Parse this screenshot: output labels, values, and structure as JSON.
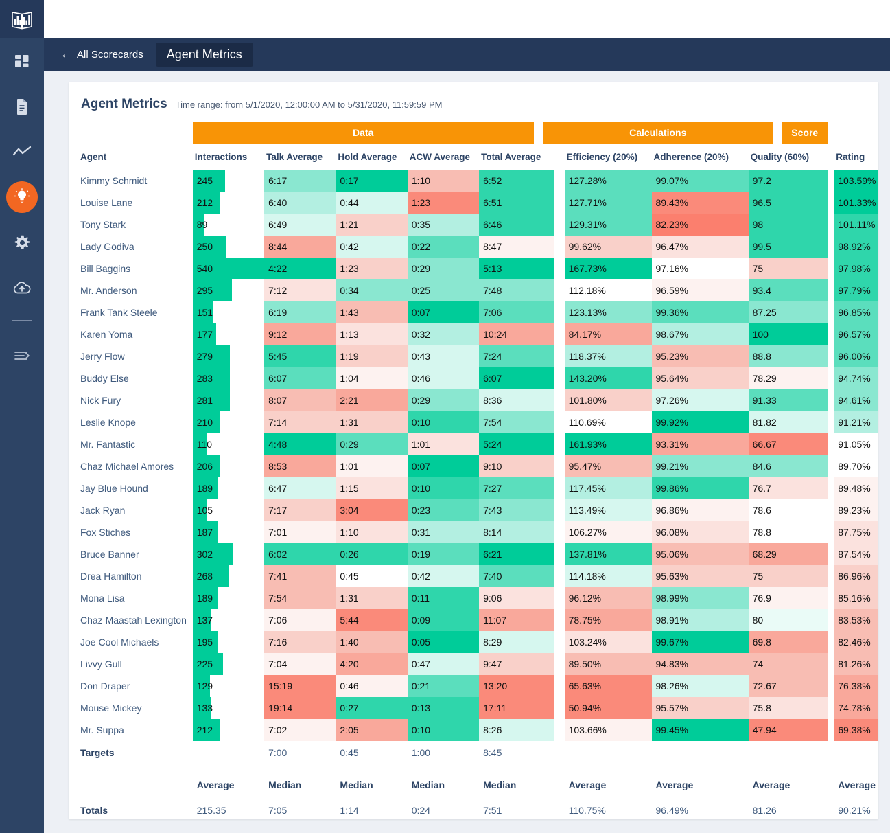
{
  "sidebar": {
    "logo_icon": "bar-chart-book-logo",
    "items": [
      {
        "icon": "dashboard-grid-icon",
        "active": false
      },
      {
        "icon": "document-icon",
        "active": false
      },
      {
        "icon": "line-chart-icon",
        "active": false
      },
      {
        "icon": "lightbulb-icon",
        "active": true
      },
      {
        "icon": "gear-icon",
        "active": false
      },
      {
        "icon": "cloud-upload-icon",
        "active": false
      }
    ],
    "collapse_icon": "menu-expand-icon",
    "active_color": "#f26722",
    "background_color": "#2d4465"
  },
  "topbar": {
    "back_icon": "arrow-left-icon",
    "back_label": "All Scorecards",
    "current_label": "Agent Metrics",
    "background_color": "#25395a"
  },
  "header": {
    "title": "Agent Metrics",
    "time_range": "Time range: from 5/1/2020, 12:00:00 AM to 5/31/2020, 11:59:59 PM"
  },
  "groups": [
    {
      "label": "Data",
      "span": 5
    },
    {
      "label": "Calculations",
      "span": 3
    },
    {
      "label": "Score",
      "span": 1
    }
  ],
  "group_color": "#f89406",
  "columns": [
    "Agent",
    "Interactions",
    "Talk Average",
    "Hold Average",
    "ACW Average",
    "Total Average",
    "Efficiency (20%)",
    "Adherence (20%)",
    "Quality (60%)",
    "Rating"
  ],
  "chart_data": {
    "type": "table",
    "title": "Agent Metrics",
    "categories": [
      "Kimmy Schmidt",
      "Louise Lane",
      "Tony Stark",
      "Lady Godiva",
      "Bill Baggins",
      "Mr. Anderson",
      "Frank Tank Steele",
      "Karen Yoma",
      "Jerry Flow",
      "Buddy Else",
      "Nick Fury",
      "Leslie Knope",
      "Mr. Fantastic",
      "Chaz Michael Amores",
      "Jay Blue Hound",
      "Jack Ryan",
      "Fox Stiches",
      "Bruce Banner",
      "Drea Hamilton",
      "Mona Lisa",
      "Chaz Maastah Lexington",
      "Joe Cool Michaels",
      "Livvy Gull",
      "Don Draper",
      "Mouse Mickey",
      "Mr. Suppa"
    ],
    "series": [
      {
        "name": "Interactions",
        "values": [
          245,
          212,
          89,
          250,
          540,
          295,
          151,
          177,
          279,
          283,
          281,
          210,
          110,
          206,
          189,
          105,
          187,
          302,
          268,
          189,
          137,
          195,
          225,
          129,
          133,
          212
        ]
      },
      {
        "name": "Rating",
        "values": [
          103.59,
          101.33,
          101.11,
          98.92,
          97.98,
          97.79,
          96.85,
          96.57,
          96.0,
          94.74,
          94.61,
          91.21,
          91.05,
          89.7,
          89.48,
          89.23,
          87.75,
          87.54,
          86.96,
          85.16,
          83.53,
          82.46,
          81.26,
          76.38,
          74.78,
          69.38
        ]
      }
    ]
  },
  "rows": [
    {
      "agent": "Kimmy Schmidt",
      "interactions": "245",
      "ibar": 45,
      "italk": 1,
      "talk": "6:17",
      "talk_c": "g3",
      "hold": "0:17",
      "hold_c": "g6",
      "acw": "1:10",
      "acw_c": "r3",
      "total": "6:52",
      "total_c": "g5",
      "eff": "127.28%",
      "eff_c": "g4",
      "adh": "99.07%",
      "adh_c": "g4",
      "qual": "97.2",
      "qual_c": "g5",
      "rate": "103.59%",
      "rate_c": "g6"
    },
    {
      "agent": "Louise Lane",
      "interactions": "212",
      "ibar": 39,
      "talk": "6:40",
      "talk_c": "g2",
      "hold": "0:44",
      "hold_c": "g1",
      "acw": "1:23",
      "acw_c": "r5",
      "total": "6:51",
      "total_c": "g5",
      "eff": "127.71%",
      "eff_c": "g4",
      "adh": "89.43%",
      "adh_c": "r5",
      "qual": "96.5",
      "qual_c": "g5",
      "rate": "101.33%",
      "rate_c": "g6"
    },
    {
      "agent": "Tony Stark",
      "interactions": "89",
      "ibar": 16,
      "talk": "6:49",
      "talk_c": "g1",
      "hold": "1:21",
      "hold_c": "r2",
      "acw": "0:35",
      "acw_c": "g2",
      "total": "6:46",
      "total_c": "g5",
      "eff": "129.31%",
      "eff_c": "g4",
      "adh": "82.23%",
      "adh_c": "r6",
      "qual": "98",
      "qual_c": "g5",
      "rate": "101.11%",
      "rate_c": "g5"
    },
    {
      "agent": "Lady Godiva",
      "interactions": "250",
      "ibar": 46,
      "talk": "8:44",
      "talk_c": "r4",
      "hold": "0:42",
      "hold_c": "g1",
      "acw": "0:22",
      "acw_c": "g4",
      "total": "8:47",
      "total_c": "r0",
      "eff": "99.62%",
      "eff_c": "r2",
      "adh": "96.47%",
      "adh_c": "r1",
      "qual": "99.5",
      "qual_c": "g5",
      "rate": "98.92%",
      "rate_c": "g5"
    },
    {
      "agent": "Bill Baggins",
      "interactions": "540",
      "ibar": 100,
      "talk": "4:22",
      "talk_c": "g6",
      "hold": "1:23",
      "hold_c": "r2",
      "acw": "0:29",
      "acw_c": "g3",
      "total": "5:13",
      "total_c": "g6",
      "eff": "167.73%",
      "eff_c": "g6",
      "adh": "97.16%",
      "adh_c": "w",
      "qual": "75",
      "qual_c": "r2",
      "rate": "97.98%",
      "rate_c": "g5"
    },
    {
      "agent": "Mr. Anderson",
      "interactions": "295",
      "ibar": 55,
      "talk": "7:12",
      "talk_c": "r1",
      "hold": "0:34",
      "hold_c": "g3",
      "acw": "0:25",
      "acw_c": "g3",
      "total": "7:48",
      "total_c": "g3",
      "eff": "112.18%",
      "eff_c": "w",
      "adh": "96.59%",
      "adh_c": "r0",
      "qual": "93.4",
      "qual_c": "g4",
      "rate": "97.79%",
      "rate_c": "g5"
    },
    {
      "agent": "Frank Tank Steele",
      "interactions": "151",
      "ibar": 28,
      "talk": "6:19",
      "talk_c": "g3",
      "hold": "1:43",
      "hold_c": "r3",
      "acw": "0:07",
      "acw_c": "g6",
      "total": "7:06",
      "total_c": "g4",
      "eff": "123.13%",
      "eff_c": "g3",
      "adh": "99.36%",
      "adh_c": "g4",
      "qual": "87.25",
      "qual_c": "g3",
      "rate": "96.85%",
      "rate_c": "g4"
    },
    {
      "agent": "Karen Yoma",
      "interactions": "177",
      "ibar": 33,
      "talk": "9:12",
      "talk_c": "r4",
      "hold": "1:13",
      "hold_c": "r1",
      "acw": "0:32",
      "acw_c": "g2",
      "total": "10:24",
      "total_c": "r4",
      "eff": "84.17%",
      "eff_c": "r4",
      "adh": "98.67%",
      "adh_c": "g2",
      "qual": "100",
      "qual_c": "g6",
      "rate": "96.57%",
      "rate_c": "g4"
    },
    {
      "agent": "Jerry Flow",
      "interactions": "279",
      "ibar": 52,
      "talk": "5:45",
      "talk_c": "g5",
      "hold": "1:19",
      "hold_c": "r2",
      "acw": "0:43",
      "acw_c": "g1",
      "total": "7:24",
      "total_c": "g4",
      "eff": "118.37%",
      "eff_c": "g2",
      "adh": "95.23%",
      "adh_c": "r3",
      "qual": "88.8",
      "qual_c": "g3",
      "rate": "96.00%",
      "rate_c": "g4"
    },
    {
      "agent": "Buddy Else",
      "interactions": "283",
      "ibar": 52,
      "talk": "6:07",
      "talk_c": "g4",
      "hold": "1:04",
      "hold_c": "r0",
      "acw": "0:46",
      "acw_c": "g1",
      "total": "6:07",
      "total_c": "g6",
      "eff": "143.20%",
      "eff_c": "g5",
      "adh": "95.64%",
      "adh_c": "r2",
      "qual": "78.29",
      "qual_c": "r0",
      "rate": "94.74%",
      "rate_c": "g3"
    },
    {
      "agent": "Nick Fury",
      "interactions": "281",
      "ibar": 52,
      "talk": "8:07",
      "talk_c": "r3",
      "hold": "2:21",
      "hold_c": "r4",
      "acw": "0:29",
      "acw_c": "g3",
      "total": "8:36",
      "total_c": "g1",
      "eff": "101.80%",
      "eff_c": "r2",
      "adh": "97.26%",
      "adh_c": "g1",
      "qual": "91.33",
      "qual_c": "g4",
      "rate": "94.61%",
      "rate_c": "g3"
    },
    {
      "agent": "Leslie Knope",
      "interactions": "210",
      "ibar": 39,
      "talk": "7:14",
      "talk_c": "r2",
      "hold": "1:31",
      "hold_c": "r2",
      "acw": "0:10",
      "acw_c": "g5",
      "total": "7:54",
      "total_c": "g3",
      "eff": "110.69%",
      "eff_c": "w",
      "adh": "99.92%",
      "adh_c": "g6",
      "qual": "81.82",
      "qual_c": "g1",
      "rate": "91.21%",
      "rate_c": "g2"
    },
    {
      "agent": "Mr. Fantastic",
      "interactions": "110",
      "ibar": 20,
      "talk": "4:48",
      "talk_c": "g6",
      "hold": "0:29",
      "hold_c": "g4",
      "acw": "1:01",
      "acw_c": "r1",
      "total": "5:24",
      "total_c": "g6",
      "eff": "161.93%",
      "eff_c": "g6",
      "adh": "93.31%",
      "adh_c": "r4",
      "qual": "66.67",
      "qual_c": "r5",
      "rate": "91.05%",
      "rate_c": "w"
    },
    {
      "agent": "Chaz Michael Amores",
      "interactions": "206",
      "ibar": 38,
      "talk": "8:53",
      "talk_c": "r4",
      "hold": "1:01",
      "hold_c": "r0",
      "acw": "0:07",
      "acw_c": "g6",
      "total": "9:10",
      "total_c": "r2",
      "eff": "95.47%",
      "eff_c": "r3",
      "adh": "99.21%",
      "adh_c": "g3",
      "qual": "84.6",
      "qual_c": "g3",
      "rate": "89.70%",
      "rate_c": "w"
    },
    {
      "agent": "Jay Blue Hound",
      "interactions": "189",
      "ibar": 35,
      "talk": "6:47",
      "talk_c": "g1",
      "hold": "1:15",
      "hold_c": "r1",
      "acw": "0:10",
      "acw_c": "g5",
      "total": "7:27",
      "total_c": "g4",
      "eff": "117.45%",
      "eff_c": "g2",
      "adh": "99.86%",
      "adh_c": "g5",
      "qual": "76.7",
      "qual_c": "r1",
      "rate": "89.48%",
      "rate_c": "r0"
    },
    {
      "agent": "Jack Ryan",
      "interactions": "105",
      "ibar": 19,
      "talk": "7:17",
      "talk_c": "r2",
      "hold": "3:04",
      "hold_c": "r5",
      "acw": "0:23",
      "acw_c": "g4",
      "total": "7:43",
      "total_c": "g3",
      "eff": "113.49%",
      "eff_c": "g1",
      "adh": "96.86%",
      "adh_c": "r0",
      "qual": "78.6",
      "qual_c": "w",
      "rate": "89.23%",
      "rate_c": "r0"
    },
    {
      "agent": "Fox Stiches",
      "interactions": "187",
      "ibar": 35,
      "talk": "7:01",
      "talk_c": "r0",
      "hold": "1:10",
      "hold_c": "r1",
      "acw": "0:31",
      "acw_c": "g2",
      "total": "8:14",
      "total_c": "g2",
      "eff": "106.27%",
      "eff_c": "r0",
      "adh": "96.08%",
      "adh_c": "r1",
      "qual": "78.8",
      "qual_c": "w",
      "rate": "87.75%",
      "rate_c": "r1"
    },
    {
      "agent": "Bruce Banner",
      "interactions": "302",
      "ibar": 56,
      "talk": "6:02",
      "talk_c": "g5",
      "hold": "0:26",
      "hold_c": "g5",
      "acw": "0:19",
      "acw_c": "g4",
      "total": "6:21",
      "total_c": "g6",
      "eff": "137.81%",
      "eff_c": "g5",
      "adh": "95.06%",
      "adh_c": "r3",
      "qual": "68.29",
      "qual_c": "r4",
      "rate": "87.54%",
      "rate_c": "r1"
    },
    {
      "agent": "Drea Hamilton",
      "interactions": "268",
      "ibar": 50,
      "talk": "7:41",
      "talk_c": "r3",
      "hold": "0:45",
      "hold_c": "w",
      "acw": "0:42",
      "acw_c": "g1",
      "total": "7:40",
      "total_c": "g4",
      "eff": "114.18%",
      "eff_c": "g1",
      "adh": "95.63%",
      "adh_c": "r2",
      "qual": "75",
      "qual_c": "r2",
      "rate": "86.96%",
      "rate_c": "r2"
    },
    {
      "agent": "Mona Lisa",
      "interactions": "189",
      "ibar": 35,
      "talk": "7:54",
      "talk_c": "r3",
      "hold": "1:31",
      "hold_c": "r2",
      "acw": "0:11",
      "acw_c": "g5",
      "total": "9:06",
      "total_c": "r1",
      "eff": "96.12%",
      "eff_c": "r3",
      "adh": "98.99%",
      "adh_c": "g3",
      "qual": "76.9",
      "qual_c": "r0",
      "rate": "85.16%",
      "rate_c": "r2"
    },
    {
      "agent": "Chaz Maastah Lexington",
      "interactions": "137",
      "ibar": 25,
      "talk": "7:06",
      "talk_c": "r0",
      "hold": "5:44",
      "hold_c": "r5",
      "acw": "0:09",
      "acw_c": "g5",
      "total": "11:07",
      "total_c": "r4",
      "eff": "78.75%",
      "eff_c": "r4",
      "adh": "98.91%",
      "adh_c": "g2",
      "qual": "80",
      "qual_c": "g0",
      "rate": "83.53%",
      "rate_c": "r3"
    },
    {
      "agent": "Joe Cool Michaels",
      "interactions": "195",
      "ibar": 36,
      "talk": "7:16",
      "talk_c": "r2",
      "hold": "1:40",
      "hold_c": "r3",
      "acw": "0:05",
      "acw_c": "g6",
      "total": "8:29",
      "total_c": "g1",
      "eff": "103.24%",
      "eff_c": "r1",
      "adh": "99.67%",
      "adh_c": "g6",
      "qual": "69.8",
      "qual_c": "r4",
      "rate": "82.46%",
      "rate_c": "r3"
    },
    {
      "agent": "Livvy Gull",
      "interactions": "225",
      "ibar": 42,
      "talk": "7:04",
      "talk_c": "r0",
      "hold": "4:20",
      "hold_c": "r4",
      "acw": "0:47",
      "acw_c": "g1",
      "total": "9:47",
      "total_c": "r2",
      "eff": "89.50%",
      "eff_c": "r3",
      "adh": "94.83%",
      "adh_c": "r3",
      "qual": "74",
      "qual_c": "r3",
      "rate": "81.26%",
      "rate_c": "r3"
    },
    {
      "agent": "Don Draper",
      "interactions": "129",
      "ibar": 24,
      "talk": "15:19",
      "talk_c": "r5",
      "hold": "0:46",
      "hold_c": "r0",
      "acw": "0:21",
      "acw_c": "g4",
      "total": "13:20",
      "total_c": "r5",
      "eff": "65.63%",
      "eff_c": "r5",
      "adh": "98.26%",
      "adh_c": "g1",
      "qual": "72.67",
      "qual_c": "r3",
      "rate": "76.38%",
      "rate_c": "r4"
    },
    {
      "agent": "Mouse Mickey",
      "interactions": "133",
      "ibar": 25,
      "talk": "19:14",
      "talk_c": "r5",
      "hold": "0:27",
      "hold_c": "g5",
      "acw": "0:13",
      "acw_c": "g5",
      "total": "17:11",
      "total_c": "r5",
      "eff": "50.94%",
      "eff_c": "r5",
      "adh": "95.57%",
      "adh_c": "r2",
      "qual": "75.8",
      "qual_c": "r1",
      "rate": "74.78%",
      "rate_c": "r4"
    },
    {
      "agent": "Mr. Suppa",
      "interactions": "212",
      "ibar": 39,
      "talk": "7:02",
      "talk_c": "r0",
      "hold": "2:05",
      "hold_c": "r4",
      "acw": "0:10",
      "acw_c": "g5",
      "total": "8:26",
      "total_c": "g1",
      "eff": "103.66%",
      "eff_c": "r0",
      "adh": "99.45%",
      "adh_c": "g6",
      "qual": "47.94",
      "qual_c": "r5",
      "rate": "69.38%",
      "rate_c": "r5"
    }
  ],
  "targets": {
    "label": "Targets",
    "interactions": "",
    "talk": "7:00",
    "hold": "0:45",
    "acw": "1:00",
    "total": "8:45",
    "eff": "",
    "adh": "",
    "qual": "",
    "rate": ""
  },
  "aggregates": {
    "interactions": "Average",
    "talk": "Median",
    "hold": "Median",
    "acw": "Median",
    "total": "Median",
    "eff": "Average",
    "adh": "Average",
    "qual": "Average",
    "rate": "Average"
  },
  "totals": {
    "label": "Totals",
    "interactions": "215.35",
    "talk": "7:05",
    "hold": "1:14",
    "acw": "0:24",
    "total": "7:51",
    "eff": "110.75%",
    "adh": "96.49%",
    "qual": "81.26",
    "rate": "90.21%"
  },
  "palette": {
    "green_max": "#00cc99",
    "red_max": "#fa8a7a",
    "white": "#ffffff",
    "bar_color": "#00cc99"
  }
}
